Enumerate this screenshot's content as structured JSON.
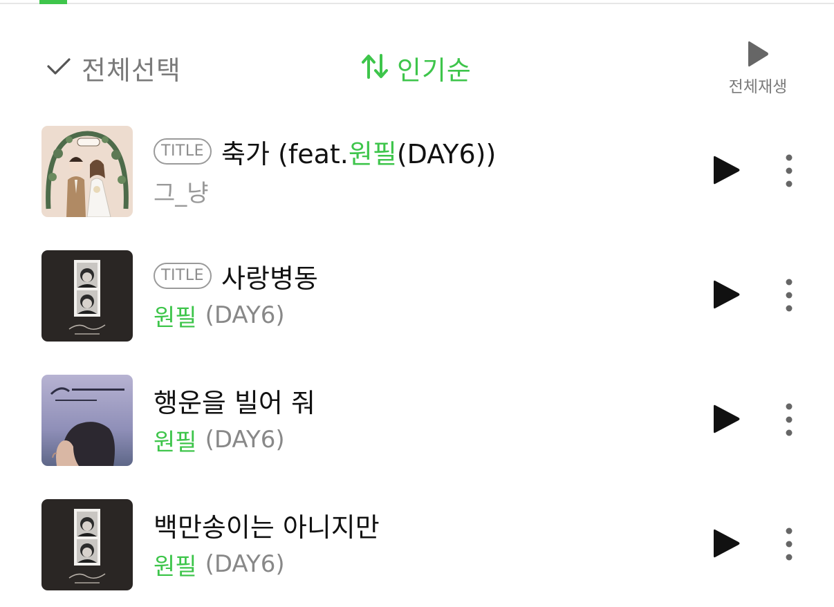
{
  "toolbar": {
    "select_all_label": "전체선택",
    "sort_label": "인기순",
    "play_all_label": "전체재생"
  },
  "colors": {
    "accent": "#3ec54b",
    "text_primary": "#111111",
    "text_secondary": "#888888"
  },
  "songs": [
    {
      "badge": "TITLE",
      "title_pre": "축가 (feat.",
      "title_highlight": "원필",
      "title_post": "(DAY6))",
      "artist_plain": "그_냥",
      "artist_green": "",
      "artist_rest": "",
      "cover": "wedding-illustration"
    },
    {
      "badge": "TITLE",
      "title_pre": "사랑병동",
      "title_highlight": "",
      "title_post": "",
      "artist_plain": "",
      "artist_green": "원필",
      "artist_rest": "(DAY6)",
      "cover": "photo-strip-dark"
    },
    {
      "badge": "",
      "title_pre": "행운을 빌어 줘",
      "title_highlight": "",
      "title_post": "",
      "artist_plain": "",
      "artist_green": "원필",
      "artist_rest": "(DAY6)",
      "cover": "filmography-portrait"
    },
    {
      "badge": "",
      "title_pre": "백만송이는 아니지만",
      "title_highlight": "",
      "title_post": "",
      "artist_plain": "",
      "artist_green": "원필",
      "artist_rest": "(DAY6)",
      "cover": "photo-strip-dark"
    }
  ]
}
